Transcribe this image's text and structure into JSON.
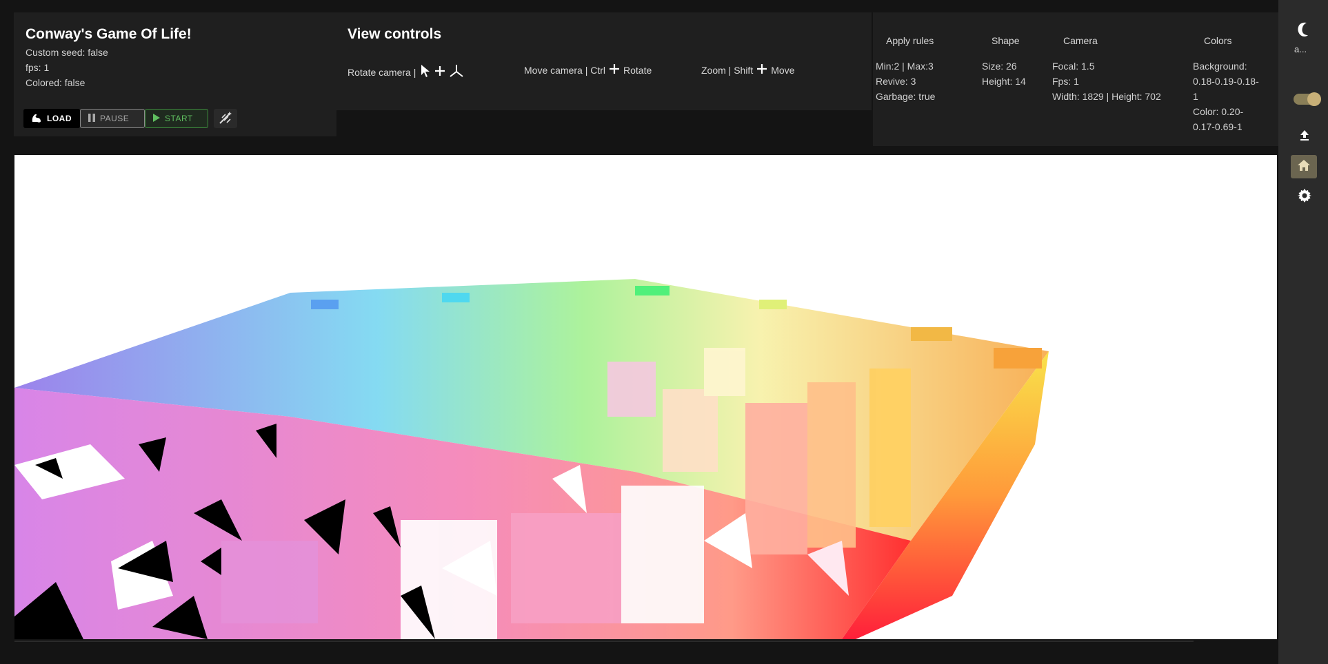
{
  "info": {
    "title": "Conway's Game Of Life!",
    "custom_seed": "Custom seed: false",
    "fps": "fps: 1",
    "colored": "Colored: false",
    "buttons": {
      "load": "LOAD",
      "pause": "PAUSE",
      "start": "START"
    }
  },
  "view": {
    "title": "View controls",
    "rotate": "Rotate camera |",
    "move": "Move camera | Ctrl",
    "move_suffix": "Rotate",
    "zoom": "Zoom | Shift",
    "zoom_suffix": "Move"
  },
  "rules": {
    "apply": {
      "header": "Apply rules",
      "line1": "Min:2 | Max:3",
      "line2": "Revive: 3",
      "line3": "Garbage: true"
    },
    "shape": {
      "header": "Shape",
      "line1": "Size: 26",
      "line2": "Height: 14"
    },
    "camera": {
      "header": "Camera",
      "line1": "Focal: 1.5",
      "line2": "Fps: 1",
      "line3": "Width: 1829 | Height: 702"
    },
    "colors": {
      "header": "Colors",
      "line1": "Background:",
      "line2": "0.18-0.19-0.18-",
      "line3": "1",
      "line4": "Color: 0.20-",
      "line5": "0.17-0.69-1"
    }
  },
  "sidebar": {
    "label": "a..."
  },
  "icons": [
    "muscle-icon",
    "pause-icon",
    "play-icon",
    "magic-wand-icon",
    "cursor-icon",
    "plus-icon",
    "axes-icon",
    "upload-icon",
    "home-icon",
    "gear-icon"
  ],
  "accent": {
    "start_green": "#5fbf5f",
    "toggle_gold": "#c8b078",
    "home_active": "#6b6550"
  }
}
